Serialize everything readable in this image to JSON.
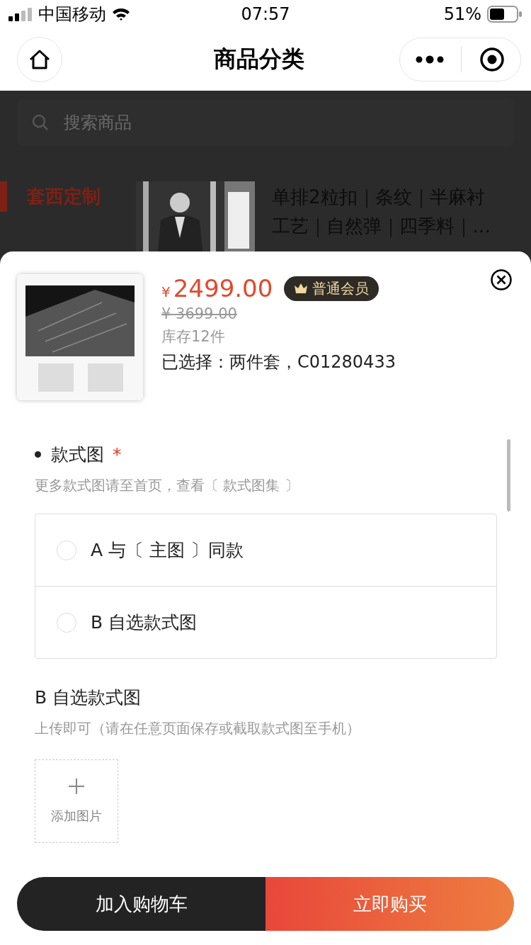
{
  "status_bar": {
    "carrier": "中国移动",
    "time": "07:57",
    "battery": "51%"
  },
  "nav_bar": {
    "title": "商品分类"
  },
  "background_page": {
    "search": {
      "placeholder": "搜索商品"
    },
    "categories": [
      {
        "label": "套西定制",
        "selected": true
      }
    ],
    "product": {
      "title": "单排2粒扣｜条纹｜半麻衬工艺｜自然弹｜四季料｜…"
    }
  },
  "sheet": {
    "price_symbol": "¥",
    "price": "2499.00",
    "member_badge": "普通会员",
    "original_price": "¥ 3699.00",
    "stock": "库存12件",
    "selected_spec": "已选择：两件套，C01280433",
    "style_section": {
      "title": "款式图",
      "required_mark": "*",
      "hint": "更多款式图请至首页，查看〔 款式图集 〕",
      "options": [
        {
          "label": "A 与〔 主图 〕同款",
          "selected": false
        },
        {
          "label": "B 自选款式图",
          "selected": false
        }
      ]
    },
    "upload_section": {
      "title": "B 自选款式图",
      "hint": "上传即可（请在任意页面保存或截取款式图至手机）",
      "add_label": "添加图片"
    },
    "buttons": [
      {
        "label": "加入购物车",
        "kind": "secondary"
      },
      {
        "label": "立即购买",
        "kind": "primary"
      }
    ]
  }
}
